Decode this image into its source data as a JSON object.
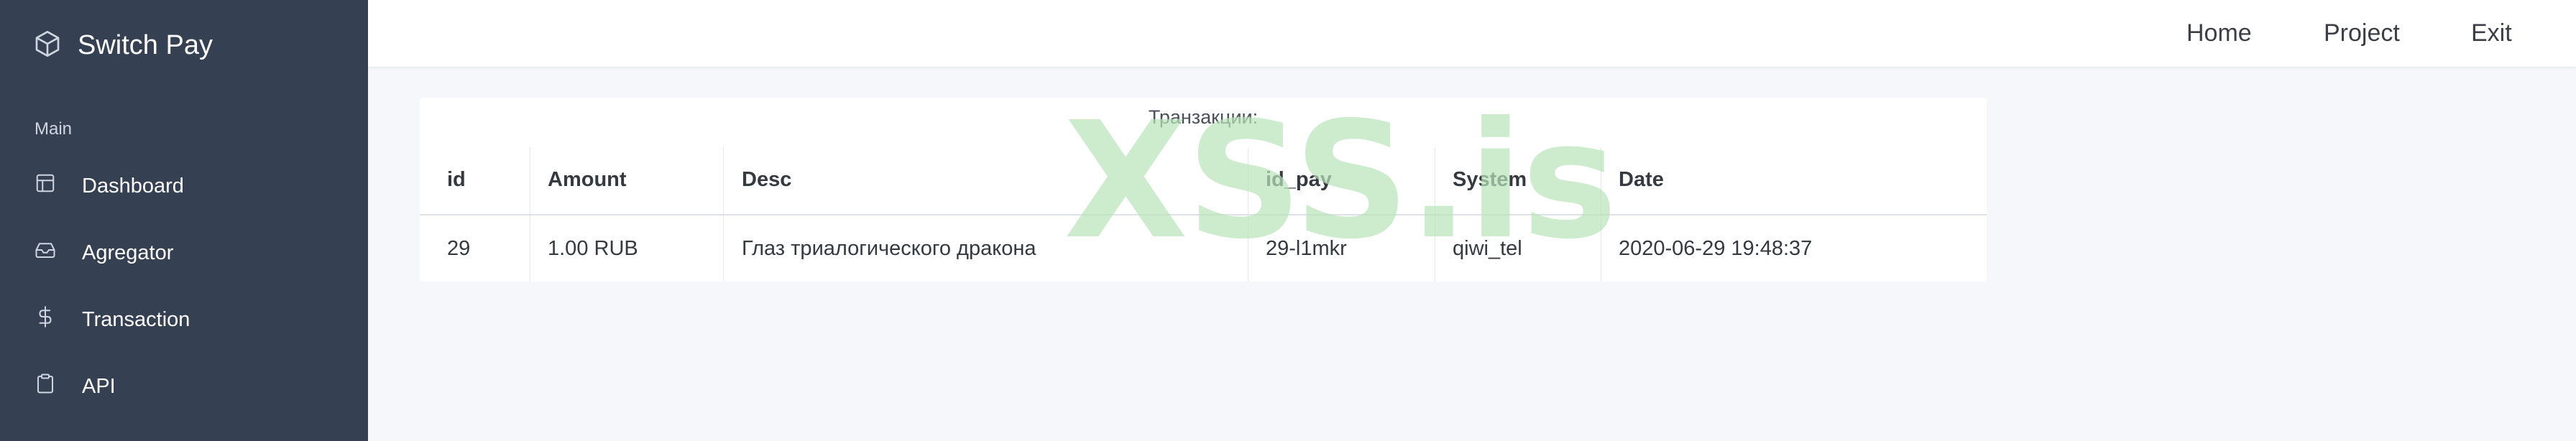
{
  "sidebar": {
    "brand": "Switch Pay",
    "section": "Main",
    "items": [
      {
        "label": "Dashboard",
        "icon": "layout-icon"
      },
      {
        "label": "Agregator",
        "icon": "inbox-icon"
      },
      {
        "label": "Transaction",
        "icon": "dollar-icon"
      },
      {
        "label": "API",
        "icon": "clipboard-icon"
      }
    ]
  },
  "topnav": {
    "home": "Home",
    "project": "Project",
    "exit": "Exit"
  },
  "transactions": {
    "title": "Транзакции:",
    "watermark": "XSS.is",
    "columns": [
      "id",
      "Amount",
      "Desc",
      "id_pay",
      "System",
      "Date"
    ],
    "rows": [
      [
        "29",
        "1.00 RUB",
        "Глаз триалогического дракона",
        "29-l1mkr",
        "qiwi_tel",
        "2020-06-29 19:48:37"
      ]
    ]
  },
  "colors": {
    "sidebar_bg": "#354052",
    "page_bg": "#f5f7fb",
    "watermark": "#b9e3b9"
  }
}
